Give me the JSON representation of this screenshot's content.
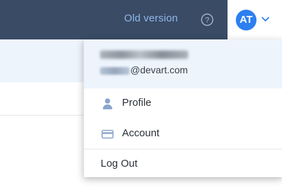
{
  "header": {
    "old_version_label": "Old version",
    "help_icon": "question-circle-icon",
    "avatar_initials": "AT",
    "avatar_color": "#2d7ff0",
    "bar_color": "#3a4b66",
    "link_color": "#8fb8ea"
  },
  "account_menu": {
    "email_domain": "@devart.com",
    "items": [
      {
        "label": "Profile",
        "icon": "user-icon"
      },
      {
        "label": "Account",
        "icon": "credit-card-icon"
      }
    ],
    "logout_label": "Log Out",
    "icon_color": "#8aa5cc"
  }
}
